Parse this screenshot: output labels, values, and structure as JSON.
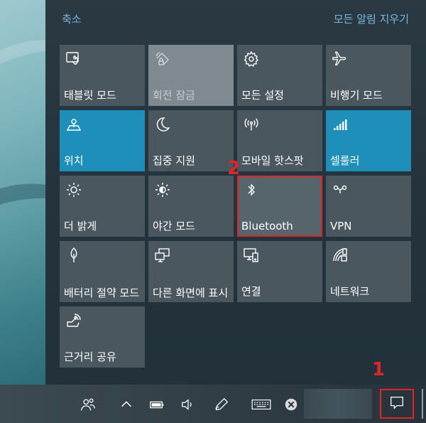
{
  "header": {
    "collapse_label": "축소",
    "clear_all_label": "모든 알림 지우기"
  },
  "tiles": [
    {
      "label": "태블릿 모드",
      "icon": "tablet-mode-icon",
      "state": "normal"
    },
    {
      "label": "회전 잠금",
      "icon": "rotation-lock-icon",
      "state": "disabled"
    },
    {
      "label": "모든 설정",
      "icon": "gear-icon",
      "state": "normal"
    },
    {
      "label": "비행기 모드",
      "icon": "airplane-icon",
      "state": "normal"
    },
    {
      "label": "위치",
      "icon": "location-icon",
      "state": "active"
    },
    {
      "label": "집중 지원",
      "icon": "moon-icon",
      "state": "normal"
    },
    {
      "label": "모바일 핫스팟",
      "icon": "hotspot-icon",
      "state": "normal"
    },
    {
      "label": "셀룰러",
      "icon": "cellular-icon",
      "state": "active"
    },
    {
      "label": "더 밝게",
      "icon": "brightness-icon",
      "state": "normal"
    },
    {
      "label": "야간 모드",
      "icon": "night-light-icon",
      "state": "normal"
    },
    {
      "label": "Bluetooth",
      "icon": "bluetooth-icon",
      "state": "highlighted"
    },
    {
      "label": "VPN",
      "icon": "vpn-icon",
      "state": "normal"
    },
    {
      "label": "배터리 절약 모드",
      "icon": "battery-saver-icon",
      "state": "normal"
    },
    {
      "label": "다른 화면에 표시",
      "icon": "project-icon",
      "state": "normal"
    },
    {
      "label": "연결",
      "icon": "connect-icon",
      "state": "normal"
    },
    {
      "label": "네트워크",
      "icon": "network-icon",
      "state": "normal"
    },
    {
      "label": "근거리 공유",
      "icon": "nearby-share-icon",
      "state": "normal"
    }
  ],
  "markers": {
    "bluetooth_marker": "2",
    "notification_marker": "1"
  },
  "taskbar": {
    "icons": [
      "people-icon",
      "chevron-up-icon",
      "battery-icon",
      "volume-icon",
      "pen-icon",
      "keyboard-icon",
      "close-circle-icon",
      "notification-icon"
    ]
  },
  "colors": {
    "accent": "#1e8fb8",
    "link": "#7ab8e0",
    "annotation": "#e0262b",
    "tile": "#4a575f"
  }
}
